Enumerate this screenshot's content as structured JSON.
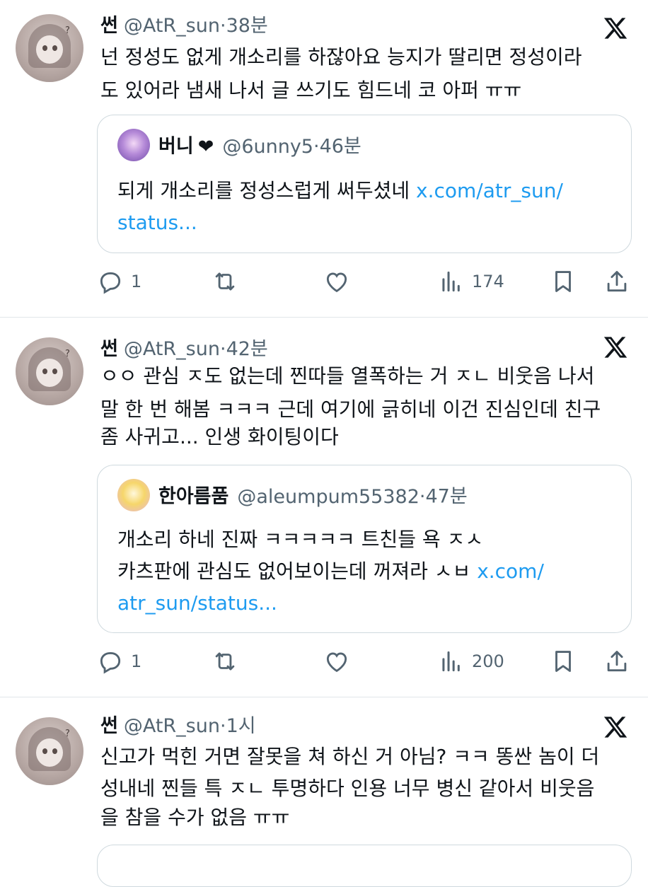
{
  "tweets": [
    {
      "author_name": "썬",
      "author_handle": "@AtR_sun",
      "separator": "·",
      "time": "38분",
      "text_lines": [
        "넌 정성도 없게 개소리를 하잖아요 능지가 딸리면 정성이라",
        "도 있어라 냄새 나서 글 쓰기도 힘드네 코 아퍼 ㅠㅠ"
      ],
      "quote": {
        "author_name": "버니",
        "heart": "❤",
        "author_handle": "@6unny5",
        "time": "46분",
        "text_lines": [
          "되게 개소리를 정성스럽게 써두셨네 "
        ],
        "link_inline": "x.com/atr_sun/",
        "link_lines": [
          "status..."
        ]
      },
      "replies": "1",
      "views": "174"
    },
    {
      "author_name": "썬",
      "author_handle": "@AtR_sun",
      "separator": "·",
      "time": "42분",
      "text_lines": [
        "ㅇㅇ 관심 ㅈ도 없는데 찐따들 열폭하는 거 ㅈㄴ 비웃음 나서",
        "말 한 번 해봄 ㅋㅋㅋ 근데 여기에 긁히네 이건 진심인데 친구",
        "좀 사귀고... 인생 화이팅이다"
      ],
      "quote": {
        "author_name": "한아름품",
        "author_handle": "@aleumpum55382",
        "time": "47분",
        "text_lines": [
          "개소리 하네 진짜 ㅋㅋㅋㅋㅋ 트친들 욕 ㅈㅅ",
          "카츠판에 관심도 없어보이는데 꺼져라 ㅅㅂ "
        ],
        "link_inline": "x.com/",
        "link_lines": [
          "atr_sun/status..."
        ]
      },
      "replies": "1",
      "views": "200"
    },
    {
      "author_name": "썬",
      "author_handle": "@AtR_sun",
      "separator": "·",
      "time": "1시",
      "text_lines": [
        "신고가 먹힌 거면 잘못을 쳐 하신 거 아님? ㅋㅋ 똥싼 놈이 더",
        "성내네 찐들 특 ㅈㄴ 투명하다 인용 너무 병신 같아서 비웃음",
        "을 참을 수가 없음 ㅠㅠ"
      ]
    }
  ],
  "icons": {
    "reply": "reply-icon",
    "retweet": "retweet-icon",
    "like": "heart-icon",
    "views": "views-icon",
    "bookmark": "bookmark-icon",
    "share": "share-icon",
    "platform": "x-logo-icon"
  },
  "colors": {
    "link": "#1d9bf0",
    "secondary_text": "#536471",
    "border": "#cfd9de"
  }
}
